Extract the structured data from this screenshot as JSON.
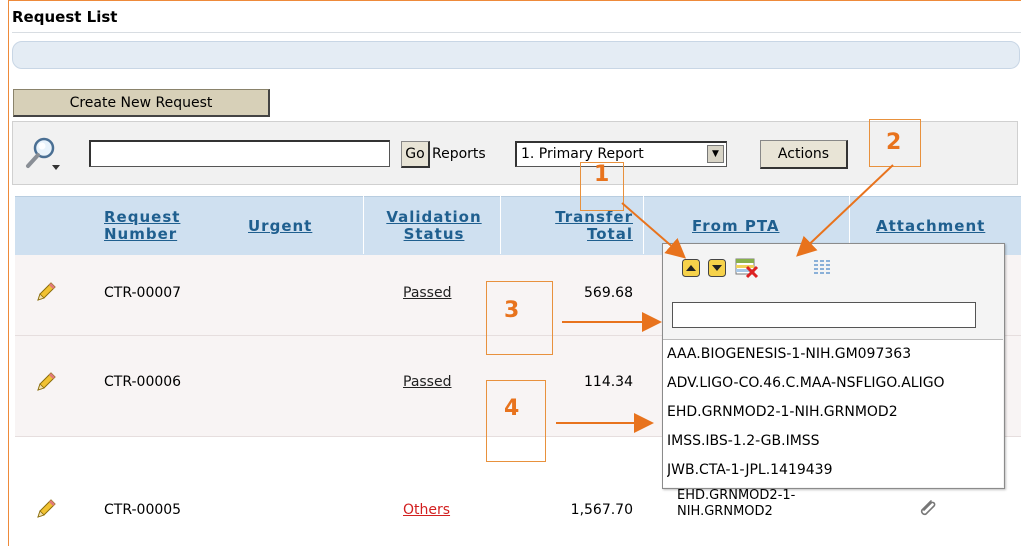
{
  "page": {
    "title": "Request List"
  },
  "toolbar": {
    "create_label": "Create New Request",
    "search_value": "",
    "go_label": "Go",
    "reports_label": "Reports",
    "reports_selected": "1. Primary Report",
    "actions_label": "Actions"
  },
  "table": {
    "headers": {
      "request_number": "Request Number",
      "urgent": "Urgent",
      "validation_status": "Validation Status",
      "transfer_total": "Transfer Total",
      "from_pta": "From PTA",
      "attachment": "Attachment"
    },
    "rows": [
      {
        "request_number": "CTR-00007",
        "validation_status": "Passed",
        "transfer_total": "569.68"
      },
      {
        "request_number": "CTR-00006",
        "validation_status": "Passed",
        "transfer_total": "114.34"
      },
      {
        "request_number": "CTR-00005",
        "validation_status": "Others",
        "transfer_total": "1,567.70",
        "from_pta": "EHD.GRNMOD2-1-NIH.GRNMOD2"
      }
    ]
  },
  "popup": {
    "filter_value": "",
    "items": [
      "AAA.BIOGENESIS-1-NIH.GM097363",
      "ADV.LIGO-CO.46.C.MAA-NSFLIGO.ALIGO",
      "EHD.GRNMOD2-1-NIH.GRNMOD2",
      "IMSS.IBS-1.2-GB.IMSS",
      "JWB.CTA-1-JPL.1419439"
    ]
  },
  "callouts": [
    "1",
    "2",
    "3",
    "4"
  ],
  "colors": {
    "callout": "#e8731d",
    "header_bg": "#cfe0f0",
    "header_text": "#1f5f8f",
    "others_status": "#d21f1f"
  },
  "icons": [
    "search-icon",
    "pencil-edit-icon",
    "move-up-icon",
    "move-down-icon",
    "clear-filter-icon",
    "column-grid-icon",
    "paperclip-icon"
  ]
}
